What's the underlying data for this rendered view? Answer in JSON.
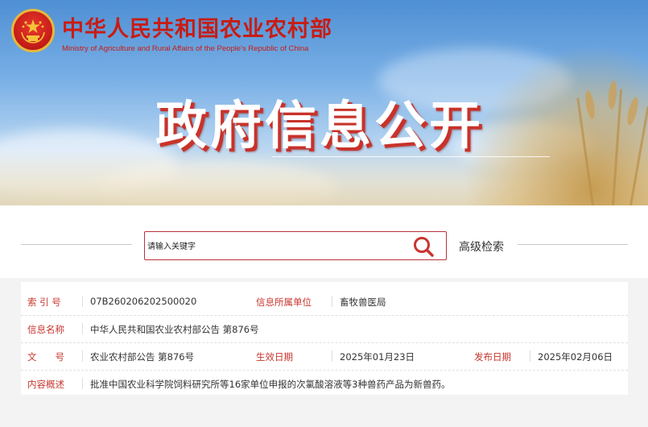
{
  "header": {
    "org_name_cn": "中华人民共和国农业农村部",
    "org_name_en": "Ministry of Agriculture and Rural Affairs of the People's Republic of China",
    "banner_title": "政府信息公开"
  },
  "search": {
    "placeholder": "请输入关键字",
    "value": "",
    "advanced_label": "高级检索"
  },
  "info": {
    "index_label": "索 引 号",
    "index_value": "07B260206202500020",
    "dept_label": "信息所属单位",
    "dept_value": "畜牧兽医局",
    "name_label": "信息名称",
    "name_value": "中华人民共和国农业农村部公告 第876号",
    "doc_label": "文　　号",
    "doc_value": "农业农村部公告 第876号",
    "effective_label": "生效日期",
    "effective_value": "2025年01月23日",
    "publish_label": "发布日期",
    "publish_value": "2025年02月06日",
    "summary_label": "内容概述",
    "summary_value": "批准中国农业科学院饲料研究所等16家单位申报的次氯酸溶液等3种兽药产品为新兽药。"
  },
  "colors": {
    "brand_red": "#c81c14",
    "label_red": "#c8362e",
    "search_border": "#b8323a"
  }
}
